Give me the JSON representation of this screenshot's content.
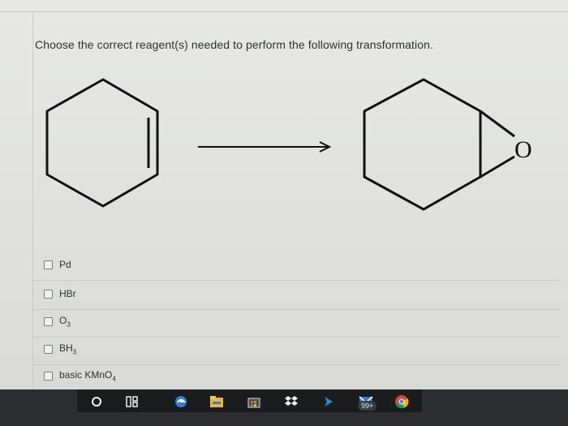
{
  "question": {
    "text": "Choose the correct reagent(s) needed to perform the following transformation."
  },
  "scheme": {
    "product_heteroatom": "O"
  },
  "options": [
    {
      "id": "pd",
      "label": "Pd",
      "sub": "",
      "after": ""
    },
    {
      "id": "hbr",
      "label": "HBr",
      "sub": "",
      "after": ""
    },
    {
      "id": "o3",
      "label": "O",
      "sub": "3",
      "after": ""
    },
    {
      "id": "bh3",
      "label": "BH",
      "sub": "3",
      "after": ""
    },
    {
      "id": "kmno4",
      "label": "basic KMnO",
      "sub": "4",
      "after": ""
    }
  ],
  "taskbar": {
    "icons": [
      "cortana-icon",
      "task-view-icon",
      "edge-icon",
      "file-explorer-icon",
      "store-icon",
      "dropbox-icon",
      "sway-icon",
      "mail-icon",
      "chrome-icon"
    ],
    "badge": "99+"
  },
  "colors": {
    "page": "#e4e5e1",
    "text": "#2e3133",
    "taskbar": "#2c2d30"
  }
}
